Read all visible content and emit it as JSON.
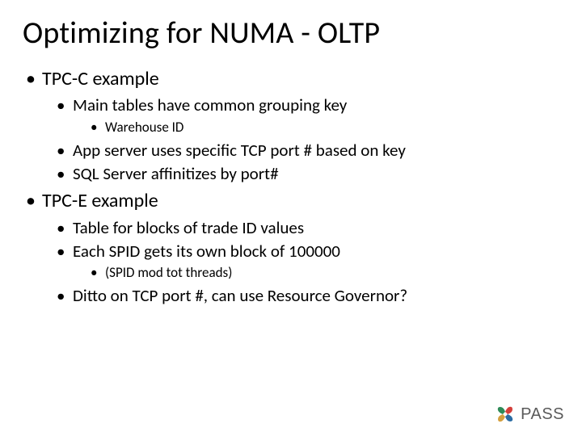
{
  "title": "Optimizing for NUMA - OLTP",
  "bullets": {
    "b1": "TPC-C example",
    "b1_1": "Main tables have common grouping key",
    "b1_1_1": "Warehouse ID",
    "b1_2": "App server uses specific TCP port # based on key",
    "b1_3": "SQL Server affinitizes by port#",
    "b2": "TPC-E example",
    "b2_1": "Table for blocks of trade ID values",
    "b2_2": "Each SPID gets its own block of 100000",
    "b2_2_1": "(SPID mod tot threads)",
    "b2_3": "Ditto on TCP port #, can use Resource Governor?"
  },
  "logo": {
    "text": "PASS"
  }
}
